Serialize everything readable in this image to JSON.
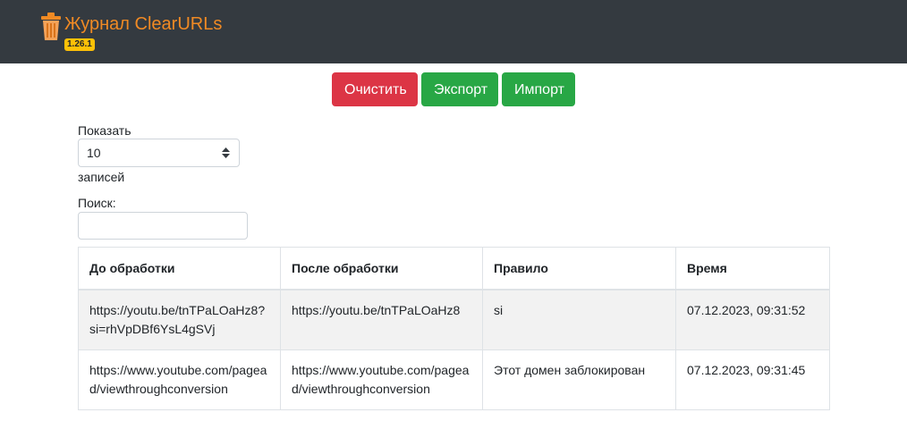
{
  "header": {
    "title": "Журнал ClearURLs",
    "version": "1.26.1",
    "icon": "trash-can-icon",
    "brand_color": "#f08a24"
  },
  "toolbar": {
    "clear_label": "Очистить",
    "export_label": "Экспорт",
    "import_label": "Импорт"
  },
  "length_control": {
    "show_label": "Показать",
    "selected": "10",
    "entries_label": "записей"
  },
  "search": {
    "label": "Поиск:",
    "value": ""
  },
  "table": {
    "headers": [
      "До обработки",
      "После обработки",
      "Правило",
      "Время"
    ],
    "rows": [
      {
        "before": "https://youtu.be/tnTPaLOaHz8?si=rhVpDBf6YsL4gSVj",
        "after": "https://youtu.be/tnTPaLOaHz8",
        "rule": "si",
        "time": "07.12.2023, 09:31:52"
      },
      {
        "before": "https://www.youtube.com/pagead/viewthroughconversion",
        "after": "https://www.youtube.com/pagead/viewthroughconversion",
        "rule": "Этот домен заблокирован",
        "time": "07.12.2023, 09:31:45"
      }
    ]
  },
  "colors": {
    "navbar": "#343a40",
    "danger": "#dc3545",
    "success": "#28a745",
    "badge": "#ffc107"
  }
}
